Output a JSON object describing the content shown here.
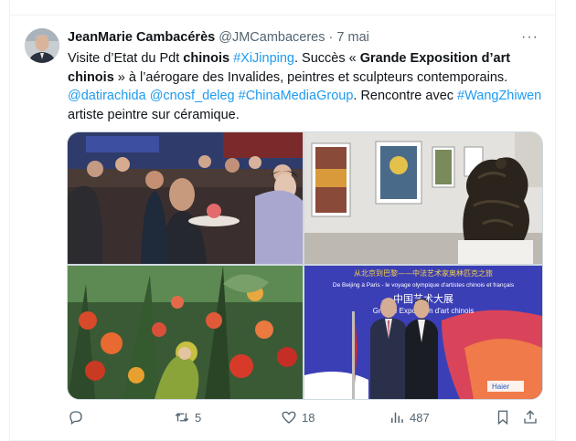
{
  "tweet": {
    "author": "JeanMarie Cambacérès",
    "handle": "@JMCambaceres",
    "separator": "·",
    "date": "7 mai",
    "more": "···",
    "text": {
      "p1": "Visite d’Etat du Pdt ",
      "b1": "chinois",
      "p2": " ",
      "l1": "#XiJinping",
      "p3": ". Succès « ",
      "b2": "Grande Exposition d’art chinois",
      "p4": " » à l’aérogare des Invalides, peintres et sculpteurs contemporains. ",
      "l2": "@datirachida",
      "p5": " ",
      "l3": "@cnosf_deleg",
      "p6": " ",
      "l4": "#ChinaMediaGroup",
      "p7": ". Rencontre avec ",
      "l5": "#WangZhiwen",
      "p8": " artiste peintre sur céramique."
    },
    "media": {
      "banner_line1": "从北京到巴黎——中法艺术家奥林匹克之旅",
      "banner_line2": "De Beijing à Paris - le voyage olympique d'artistes chinois et français",
      "banner_line3": "中国艺术大展",
      "banner_line4": "Grande Exposition d'art chinois",
      "sponsor": "Haier"
    },
    "actions": {
      "reply": "",
      "retweets": "5",
      "likes": "18",
      "views": "487"
    }
  },
  "icons": [
    "reply-icon",
    "retweet-icon",
    "like-icon",
    "views-icon",
    "bookmark-icon",
    "share-icon",
    "more-icon"
  ],
  "colors": {
    "link": "#1d9bf0",
    "text": "#0f1419",
    "muted": "#536471"
  }
}
